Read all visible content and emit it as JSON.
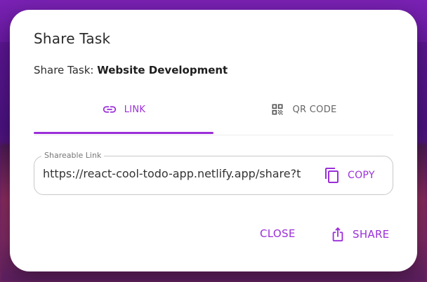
{
  "dialog": {
    "title": "Share Task",
    "subtitle_prefix": "Share Task: ",
    "task_name": "Website Development"
  },
  "tabs": [
    {
      "label": "LINK",
      "icon": "link-icon",
      "selected": true
    },
    {
      "label": "QR CODE",
      "icon": "qr-code-icon",
      "selected": false
    }
  ],
  "link_field": {
    "label": "Shareable Link",
    "value": "https://react-cool-todo-app.netlify.app/share?t",
    "copy_label": "COPY"
  },
  "actions": {
    "close_label": "CLOSE",
    "share_label": "SHARE"
  },
  "colors": {
    "accent": "#9b2fd9",
    "background_overlay": "#5a1590"
  }
}
